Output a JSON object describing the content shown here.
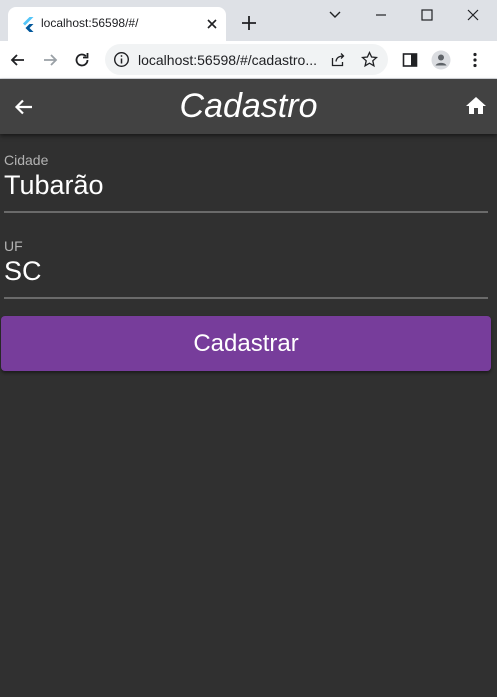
{
  "browser": {
    "tab_title": "localhost:56598/#/",
    "url": "localhost:56598/#/cadastro...",
    "icons": [
      "flutter-favicon-icon",
      "close-icon",
      "plus-icon",
      "chevron-down-icon",
      "minimize-icon",
      "maximize-icon",
      "close-window-icon",
      "back-arrow-icon",
      "forward-arrow-icon",
      "reload-icon",
      "info-icon",
      "share-icon",
      "star-icon",
      "side-panel-icon",
      "profile-icon",
      "menu-dots-icon"
    ]
  },
  "appbar": {
    "title": "Cadastro",
    "icons": [
      "arrow-back-icon",
      "home-icon"
    ]
  },
  "form": {
    "cidade": {
      "label": "Cidade",
      "value": "Tubarão"
    },
    "uf": {
      "label": "UF",
      "value": "SC"
    },
    "submit_label": "Cadastrar"
  },
  "colors": {
    "background": "#303030",
    "appbar": "#424242",
    "button": "#773d9b",
    "underline": "#6a6a6a"
  }
}
